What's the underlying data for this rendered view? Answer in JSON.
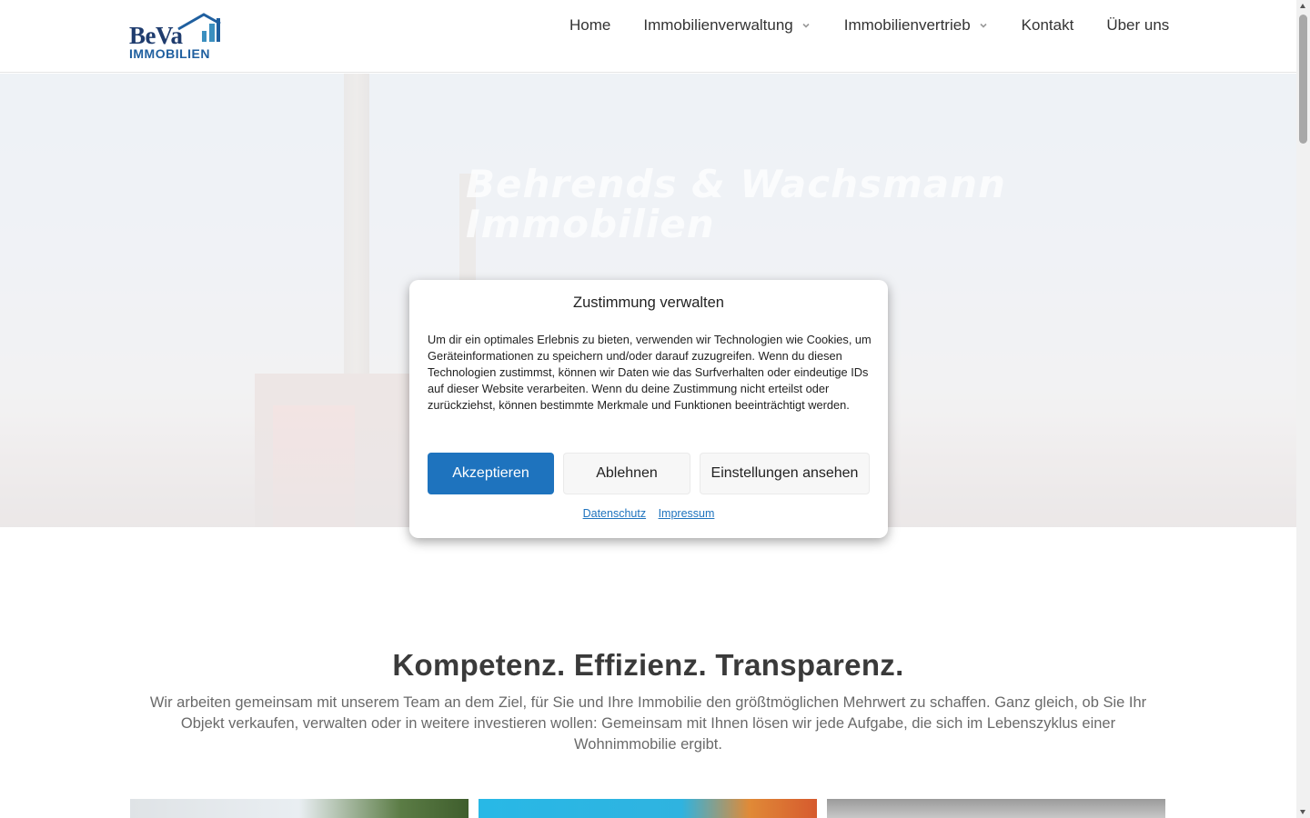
{
  "header": {
    "logo": {
      "brand": "BeVa",
      "subtitle": "IMMOBILIEN",
      "icon": "house-logo-icon",
      "color_primary": "#1f3c6e",
      "color_accent": "#1f5f9f"
    },
    "nav": [
      {
        "label": "Home",
        "has_dropdown": false
      },
      {
        "label": "Immobilienverwaltung",
        "has_dropdown": true
      },
      {
        "label": "Immobilienvertrieb",
        "has_dropdown": true
      },
      {
        "label": "Kontakt",
        "has_dropdown": false
      },
      {
        "label": "Über uns",
        "has_dropdown": false
      }
    ]
  },
  "hero": {
    "title": "Behrends & Wachsmann Immobilien"
  },
  "consent_modal": {
    "title": "Zustimmung verwalten",
    "body": "Um dir ein optimales Erlebnis zu bieten, verwenden wir Technologien wie Cookies, um Geräteinformationen zu speichern und/oder darauf zuzugreifen. Wenn du diesen Technologien zustimmst, können wir Daten wie das Surfverhalten oder eindeutige IDs auf dieser Website verarbeiten. Wenn du deine Zustimmung nicht erteilst oder zurückziehst, können bestimmte Merkmale und Funktionen beeinträchtigt werden.",
    "accept_label": "Akzeptieren",
    "deny_label": "Ablehnen",
    "settings_label": "Einstellungen ansehen",
    "links": {
      "privacy": "Datenschutz",
      "imprint": "Impressum"
    },
    "accent_color": "#1e73be"
  },
  "main": {
    "title": "Kompetenz. Effizienz. Transparenz.",
    "text": "Wir arbeiten gemeinsam mit unserem Team an dem Ziel, für Sie und Ihre Immobilie den größtmöglichen Mehrwert zu schaffen. Ganz gleich, ob Sie Ihr Objekt verkaufen, verwalten oder in weitere investieren wollen: Gemeinsam mit Ihnen lösen wir jede Aufgabe, die sich im Lebenszyklus einer Wohnimmobilie ergibt."
  }
}
